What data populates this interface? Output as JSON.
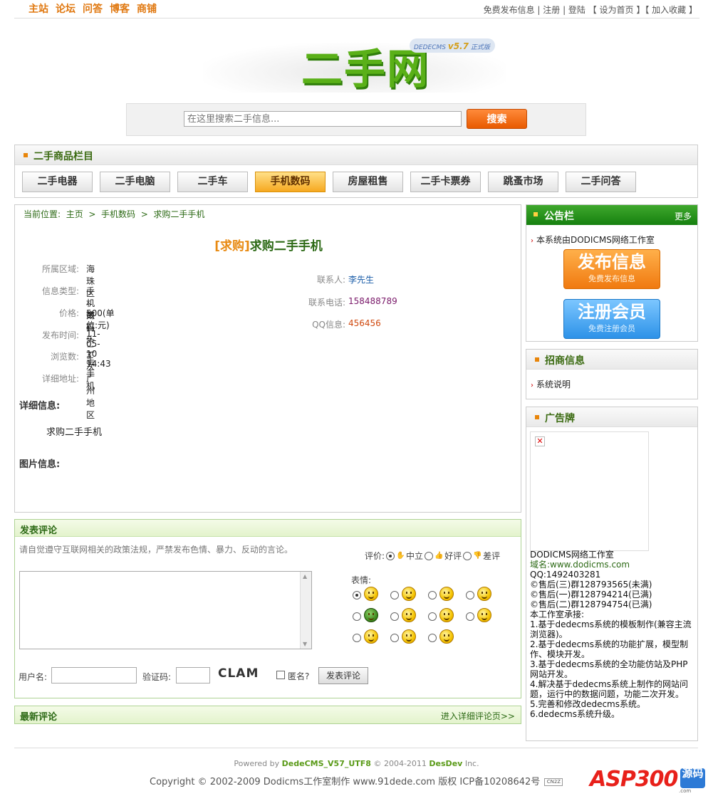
{
  "topnav": [
    "主站",
    "论坛",
    "问答",
    "博客",
    "商铺"
  ],
  "toplinks": "免费发布信息 | 注册 | 登陆 【 设为首页 】【 加入收藏 】",
  "logo": {
    "text": "二手网",
    "badge_brand": "DEDECMS",
    "badge_version": "v5.7",
    "badge_edition": "正式版"
  },
  "search": {
    "placeholder": "在这里搜索二手信息...",
    "button": "搜索"
  },
  "category": {
    "title": "二手商品栏目",
    "tabs": [
      "二手电器",
      "二手电脑",
      "二手车",
      "手机数码",
      "房屋租售",
      "二手卡票券",
      "跳蚤市场",
      "二手问答"
    ],
    "active": 3
  },
  "breadcrumb": {
    "prefix": "当前位置:",
    "items": [
      "主页",
      ">",
      "手机数码",
      ">",
      "求购二手手机"
    ]
  },
  "detail": {
    "tag": "[求购]",
    "title": "求购二手手机",
    "left_fields": [
      {
        "label": "所属区域:",
        "value": "海珠区 -- 南石头"
      },
      {
        "label": "信息类型:",
        "value": "手机数码 -- 二手手机"
      },
      {
        "label": "价格:",
        "value": "500(单位:元)"
      },
      {
        "label": "发布时间:",
        "value": "11-05-10 14:43"
      },
      {
        "label": "浏览数:",
        "value": "3次"
      },
      {
        "label": "详细地址:",
        "value": "广州地区"
      }
    ],
    "right_fields": [
      {
        "label": "联系人:",
        "value": "李先生",
        "color": "#1a5ca8"
      },
      {
        "label": "联系电话:",
        "value": "158488789",
        "color": "#7a1a6a"
      },
      {
        "label": "QQ信息:",
        "value": "456456",
        "color": "#d04a10"
      }
    ],
    "detail_label": "详细信息:",
    "description": "求购二手手机",
    "image_label": "图片信息:"
  },
  "comment": {
    "title": "发表评论",
    "notice": "请自觉遵守互联网相关的政策法规，严禁发布色情、暴力、反动的言论。",
    "rating_label": "评价:",
    "ratings": [
      "中立",
      "好评",
      "差评"
    ],
    "emotion_label": "表情:",
    "username_label": "用户名:",
    "captcha_label": "验证码:",
    "captcha_text": "CLAM",
    "anonymous_label": "匿名?",
    "submit": "发表评论"
  },
  "latest": {
    "title": "最新评论",
    "more": "进入详细评论页>>"
  },
  "notice_board": {
    "title": "公告栏",
    "more": "更多",
    "item": "本系统由DODICMS网络工作室",
    "publish": {
      "main": "发布信息",
      "sub": "免费发布信息"
    },
    "register": {
      "main": "注册会员",
      "sub": "免费注册会员"
    }
  },
  "business": {
    "title": "招商信息",
    "item": "系统说明"
  },
  "ads": {
    "title": "广告牌",
    "lines": [
      "DODICMS网络工作室",
      "域名:www.dodicms.com",
      "QQ:1492403281",
      "©售后(三)群128793565(未满)",
      "©售后(一)群128794214(已满)",
      "©售后(二)群128794754(已满)",
      "本工作室承接:",
      "1.基于dedecms系统的模板制作(兼容主流浏览器)。",
      "2.基于dedecms系统的功能扩展，模型制作、模块开发。",
      "3.基于dedecms系统的全功能仿站及PHP网站开发。",
      "4.解决基于dedecms系统上制作的网站问题，运行中的数据问题，功能二次开发。",
      "5.完善和修改dedecms系统。",
      "6.dedecms系统升级。"
    ]
  },
  "footer": {
    "powered": "Powered by",
    "product": "DedeCMS_V57_UTF8",
    "copy_mid": "© 2004-2011",
    "company": "DesDev",
    "inc": "Inc.",
    "line2": "Copyright © 2002-2009 Dodicms工作室制作 www.91dede.com 版权  ICP备10208642号",
    "flag": "CN2Z",
    "watermark": "ASP300",
    "watermark_badge": "源码",
    "watermark_url": ".com"
  }
}
